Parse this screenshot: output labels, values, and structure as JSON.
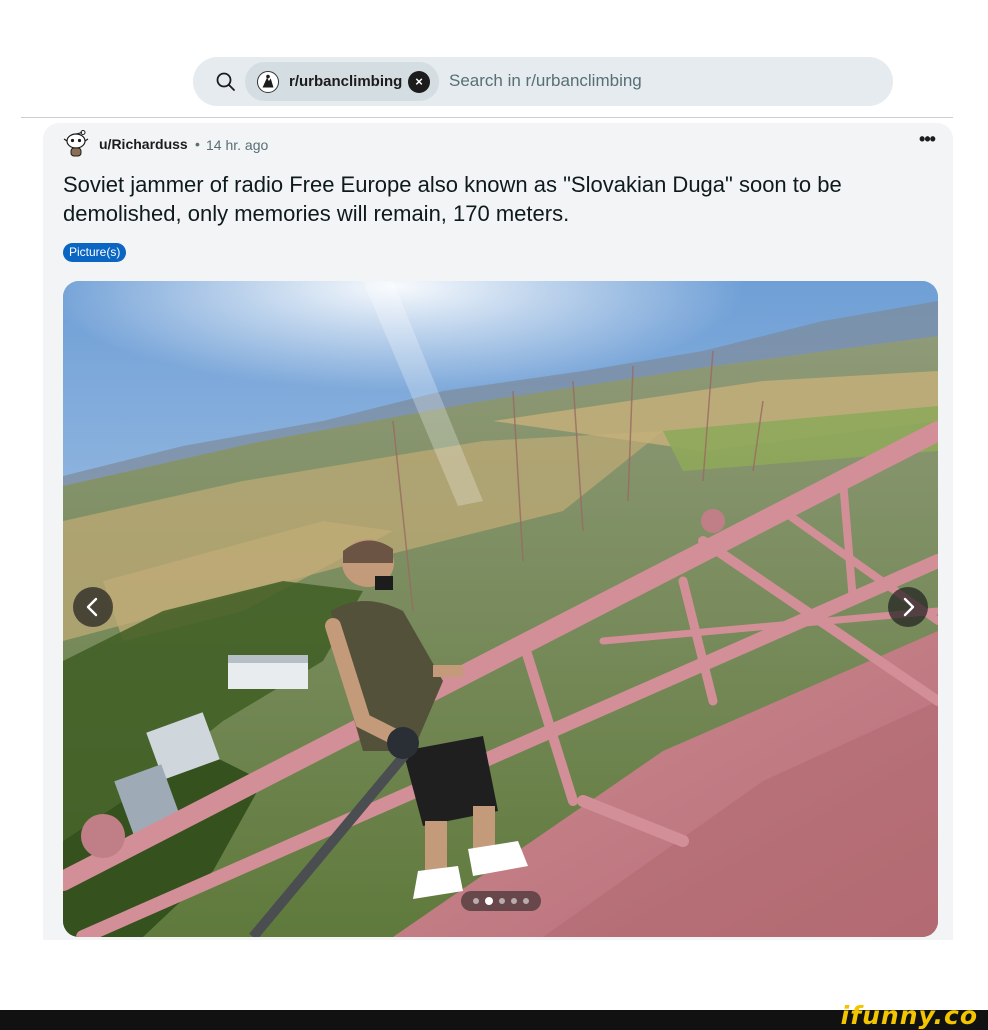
{
  "search": {
    "community_chip": "r/urbanclimbing",
    "close_glyph": "×",
    "placeholder": "Search in r/urbanclimbing"
  },
  "post": {
    "author": "u/Richarduss",
    "separator": "•",
    "time": "14 hr. ago",
    "more_glyph": "•••",
    "title": "Soviet jammer of radio Free Europe also known as \"Slovakian Duga\" soon to be demolished, only memories will remain, 170 meters.",
    "flair": "Picture(s)",
    "flair_color": "#0a66c2",
    "gallery": {
      "dot_count": 5,
      "active_index": 1
    }
  },
  "footer": {
    "watermark": "ifunny.co"
  },
  "colors": {
    "search_bg": "#e5ebee",
    "card_bg": "#f2f4f5",
    "watermark": "#f2c500"
  },
  "icons": [
    "search-icon",
    "subreddit-avatar-icon",
    "close-icon",
    "reddit-snoo-avatar-icon",
    "more-options-icon",
    "chevron-left-icon",
    "chevron-right-icon"
  ]
}
